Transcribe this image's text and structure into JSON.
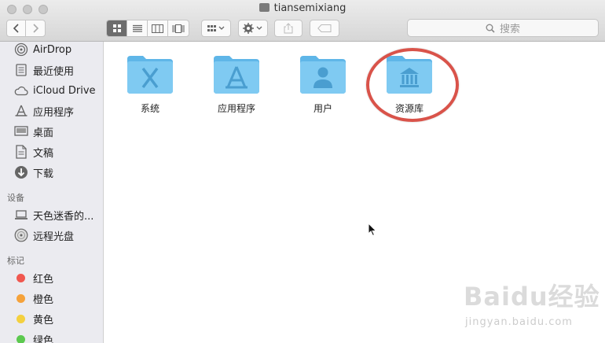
{
  "window": {
    "title": "tiansemixiang"
  },
  "toolbar": {
    "search_placeholder": "搜索"
  },
  "sidebar": {
    "favorites": [
      {
        "label": "AirDrop",
        "icon": "airdrop-icon"
      },
      {
        "label": "最近使用",
        "icon": "recents-icon"
      },
      {
        "label": "iCloud Drive",
        "icon": "cloud-icon"
      },
      {
        "label": "应用程序",
        "icon": "applications-icon"
      },
      {
        "label": "桌面",
        "icon": "desktop-icon"
      },
      {
        "label": "文稿",
        "icon": "documents-icon"
      },
      {
        "label": "下载",
        "icon": "downloads-icon"
      }
    ],
    "devices_header": "设备",
    "devices": [
      {
        "label": "天色迷香的...",
        "icon": "laptop-icon"
      },
      {
        "label": "远程光盘",
        "icon": "disc-icon"
      }
    ],
    "tags_header": "标记",
    "tags": [
      {
        "label": "红色",
        "color": "#f0574f"
      },
      {
        "label": "橙色",
        "color": "#f5a23a"
      },
      {
        "label": "黄色",
        "color": "#f4d03f"
      },
      {
        "label": "绿色",
        "color": "#5cc94f"
      }
    ]
  },
  "content": {
    "folders": [
      {
        "label": "系统",
        "icon": "system-folder-icon"
      },
      {
        "label": "应用程序",
        "icon": "applications-folder-icon"
      },
      {
        "label": "用户",
        "icon": "users-folder-icon"
      },
      {
        "label": "资源库",
        "icon": "library-folder-icon"
      }
    ]
  },
  "watermark": {
    "brand": "Baidu经验",
    "url": "jingyan.baidu.com"
  },
  "colors": {
    "folder": "#6ec3f0",
    "highlight_circle": "#d9534a"
  }
}
